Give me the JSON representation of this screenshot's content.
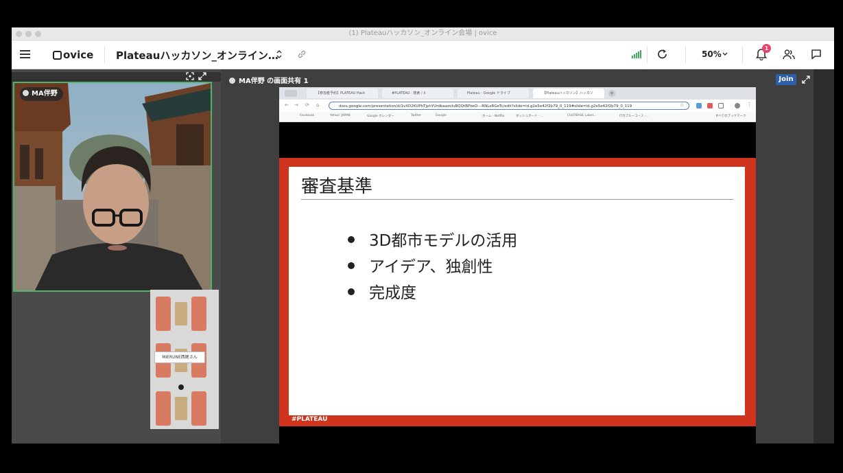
{
  "window": {
    "title": "(1) Plateauハッカソン_オンライン会場 | ovice"
  },
  "toolbar": {
    "logo_text": "ovice",
    "space_name": "Plateauハッカソン_オンライン…",
    "zoom_level": "50%",
    "notification_count": "1"
  },
  "camera": {
    "user_label": "MA伴野"
  },
  "map": {
    "name_tag": "MIERUNE西尾さん"
  },
  "screen_share": {
    "label": "MA伴野 の画面共有 1",
    "join_label": "Join"
  },
  "browser": {
    "tabs": [
      {
        "label": "【参加者予約】PLATEAU Hack"
      },
      {
        "label": "#PLATEAU - 検索 / X"
      },
      {
        "label": "Plateau - Google ドライブ"
      },
      {
        "label": "【Plateauハッカソン】ハッカソ"
      }
    ],
    "url": "docs.google.com/presentation/d/1vXD2KUPhTjphYUrdbaazoIuBQQtBPbeD---RNLxRGeTc/edit?slide=id.g2e5e42f2b79_0_119#slide=id.g2e5e42f2b79_0_119",
    "bookmarks": [
      "Facebook",
      "Yahoo! JAPAN",
      "Google カレンダー",
      "Twitter",
      "Google",
      "ホーム - Netflix",
      "ダッシュボード - ...",
      "CULTIBASE Label...",
      "ITのプルーコース -..."
    ],
    "bookmarks_right": "すべてのブックマーク"
  },
  "slide": {
    "title": "審査基準",
    "bullets": [
      "3D都市モデルの活用",
      "アイデア、独創性",
      "完成度"
    ],
    "footer_tag": "#PLATEAU"
  },
  "colors": {
    "slide_frame": "#d0341f",
    "camera_border": "#4fb36b",
    "join_button": "#2c5fa8",
    "badge": "#e8446a"
  }
}
